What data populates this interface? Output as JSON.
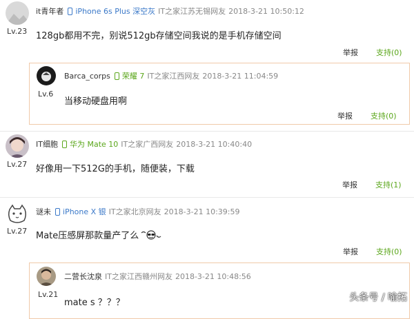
{
  "comments": [
    {
      "user": "it青年者",
      "device": "iPhone 6s Plus 深空灰",
      "source": "IT之家江苏无锡网友",
      "time": "2018-3-21 10:50:12",
      "level": "Lv.23",
      "text": "128gb都用不完，别说512gb存储空间我说的是手机存储空间",
      "report": "举报",
      "support": "支持(0)",
      "reply": {
        "user": "Barca_corps",
        "device": "荣耀 7",
        "source": "IT之家江西网友",
        "time": "2018-3-21 11:04:59",
        "level": "Lv.6",
        "text": "当移动硬盘用啊",
        "report": "举报",
        "support": "支持(0)"
      }
    },
    {
      "user": "IT细胞",
      "device": "华为 Mate 10",
      "source": "IT之家广西网友",
      "time": "2018-3-21 10:40:40",
      "level": "Lv.27",
      "text": "好像用一下512G的手机，随便装，下载",
      "report": "举报",
      "support": "支持(1)"
    },
    {
      "user": "谜未",
      "device": "iPhone X 银",
      "source": "IT之家北京网友",
      "time": "2018-3-21 10:39:59",
      "level": "Lv.27",
      "text": "Mate压感屏那款量产了么",
      "report": "举报",
      "support": "支持(0)",
      "reply": {
        "user": "二营长沈泉",
        "source": "IT之家江西赣州网友",
        "time": "2018-3-21 10:48:56",
        "level": "Lv.21",
        "text": "mate s ？？？"
      }
    }
  ],
  "watermark": "头条号 / 喻拓",
  "colors": {
    "accent_blue": "#3a78c8",
    "accent_green": "#5aa61a",
    "reply_border": "#f0c9a8"
  }
}
